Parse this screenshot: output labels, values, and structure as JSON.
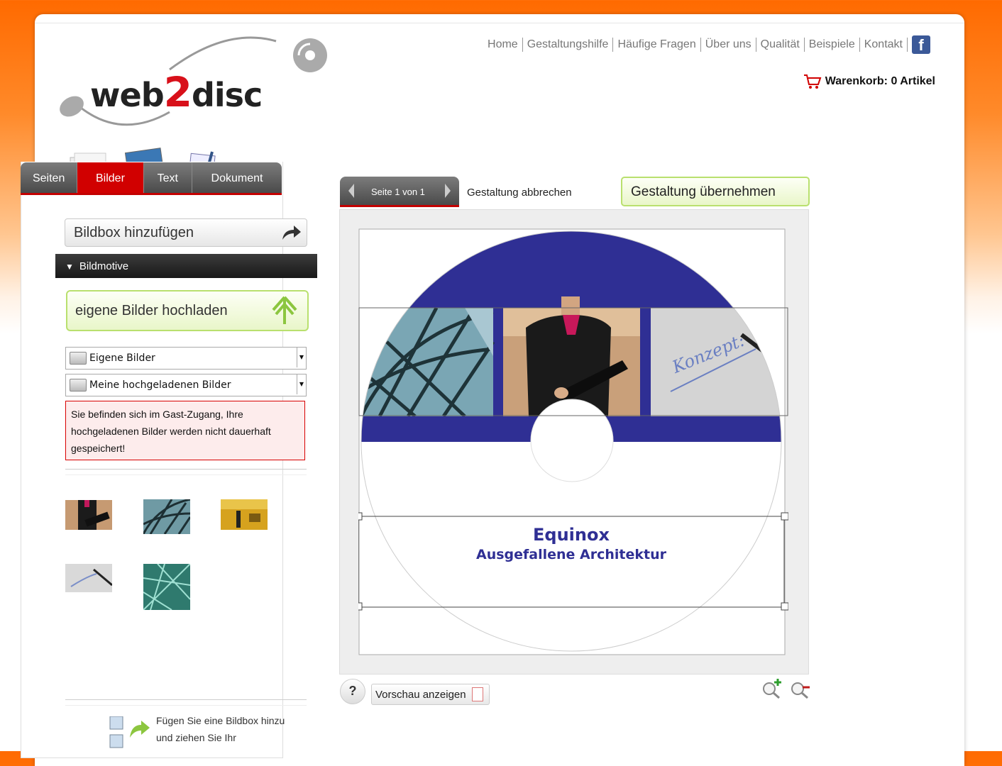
{
  "brand": {
    "logo_text_1": "web",
    "logo_text_2": "2",
    "logo_text_3": "disc"
  },
  "topnav": [
    "Home",
    "Gestaltungshilfe",
    "Häufige Fragen",
    "Über uns",
    "Qualität",
    "Beispiele",
    "Kontakt"
  ],
  "facebook_label": "f",
  "cart": {
    "label": "Warenkorb: 0 Artikel"
  },
  "tabs": [
    "Seiten",
    "Bilder",
    "Text",
    "Dokument"
  ],
  "active_tab": "Bilder",
  "left": {
    "add_box": "Bildbox hinzufügen",
    "section": "Bildmotive",
    "upload": "eigene Bilder hochladen",
    "select_source": "Eigene Bilder",
    "select_folder": "Meine hochgeladenen Bilder",
    "warning": "Sie befinden sich im Gast-Zugang, Ihre hochgeladenen Bilder werden nicht dauerhaft gespeichert!",
    "help_text": "Fügen Sie eine Bildbox hinzu und ziehen Sie Ihr"
  },
  "editor": {
    "page_indicator": "Seite 1 von 1",
    "cancel": "Gestaltung abbrechen",
    "apply": "Gestaltung übernehmen",
    "preview": "Vorschau anzeigen",
    "help": "?",
    "disc_title": "Equinox",
    "disc_subtitle": "Ausgefallene Architektur",
    "concept_word": "Konzept:"
  },
  "colors": {
    "accent_red": "#d10000",
    "disc_blue": "#2f2f94",
    "upload_green": "#b9e06e"
  }
}
